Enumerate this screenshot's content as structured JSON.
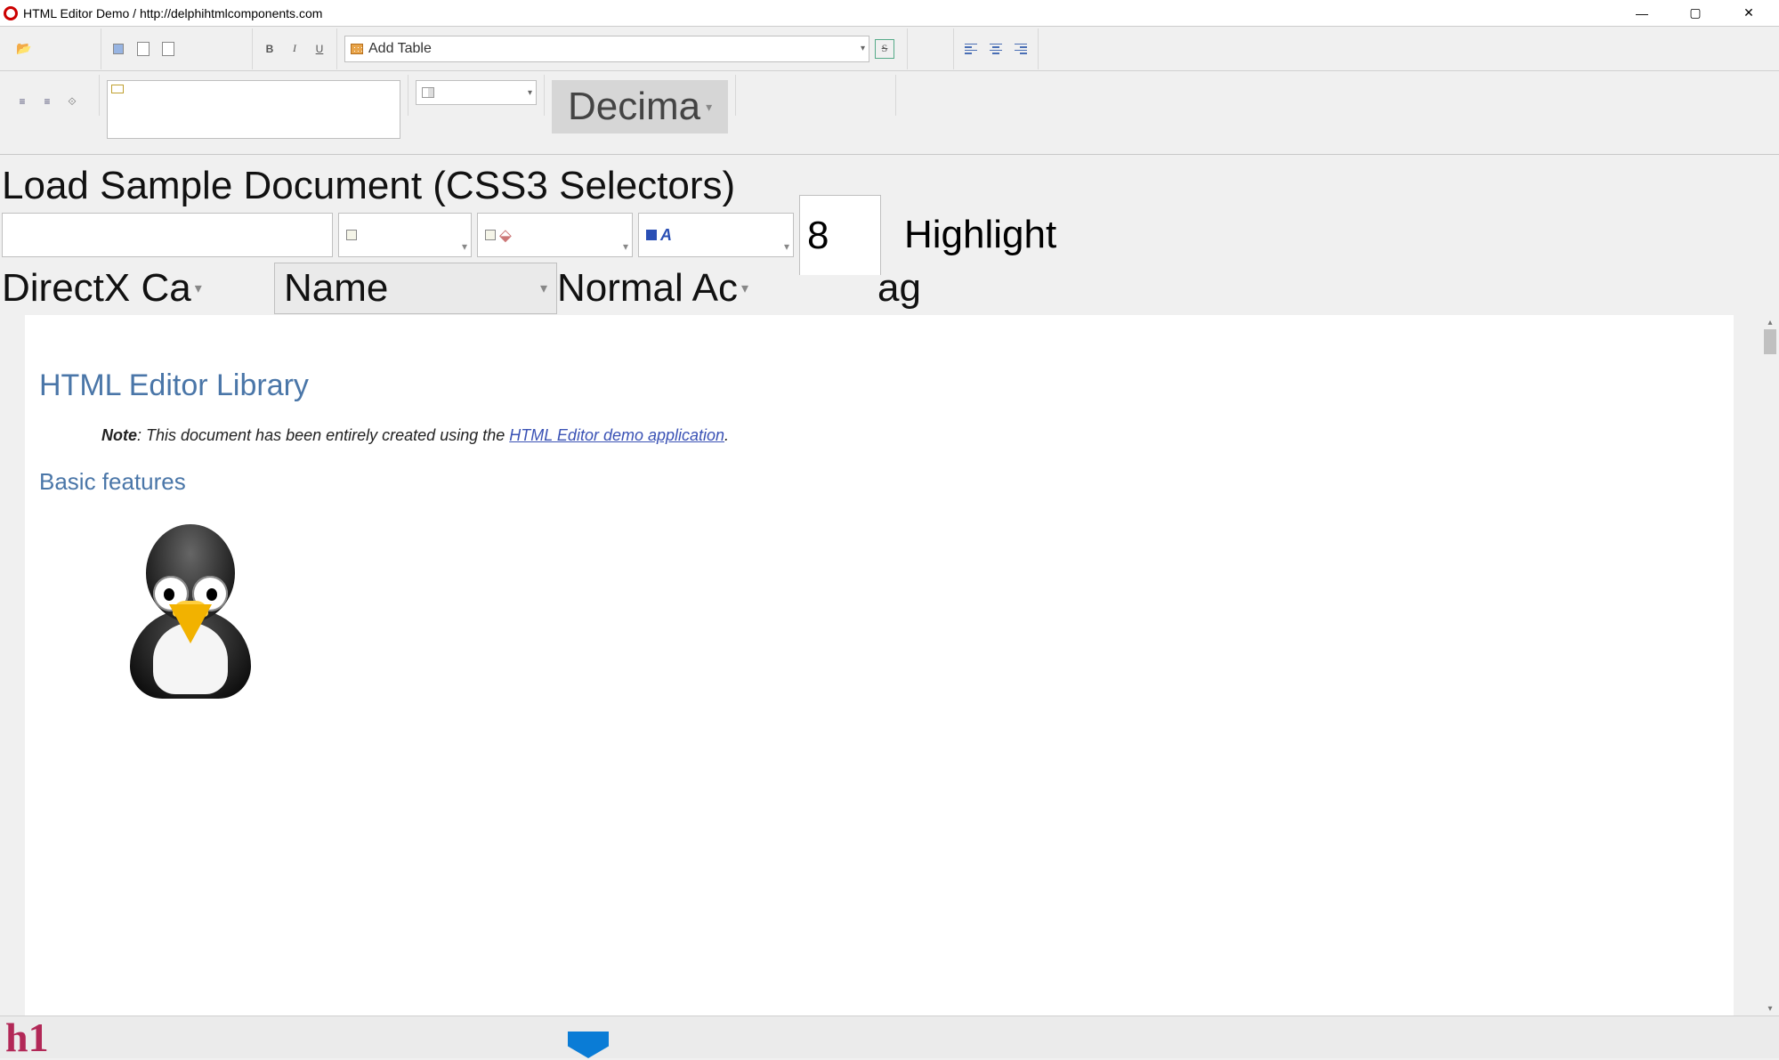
{
  "window": {
    "title": "HTML Editor Demo / http://delphihtmlcomponents.com"
  },
  "toolbar1": {
    "add_table_label": "Add Table",
    "bold": "B",
    "italic": "I",
    "underline": "U",
    "strike": "S"
  },
  "toolbar2": {
    "font_label": "Decima"
  },
  "bigrow": {
    "load_sample": "Load Sample Document (CSS3 Selectors)",
    "size_value": "8",
    "highlight": "Highlight",
    "directx": "DirectX Ca",
    "name": "Name",
    "normalac": "Normal Ac",
    "ag": "ag"
  },
  "document": {
    "h1": "HTML Editor Library",
    "note_bold": "Note",
    "note_rest": ": This document has been entirely created using the ",
    "note_link": "HTML Editor demo application",
    "note_dot": ".",
    "h2": "Basic features"
  },
  "footer": {
    "tag": "h1"
  }
}
